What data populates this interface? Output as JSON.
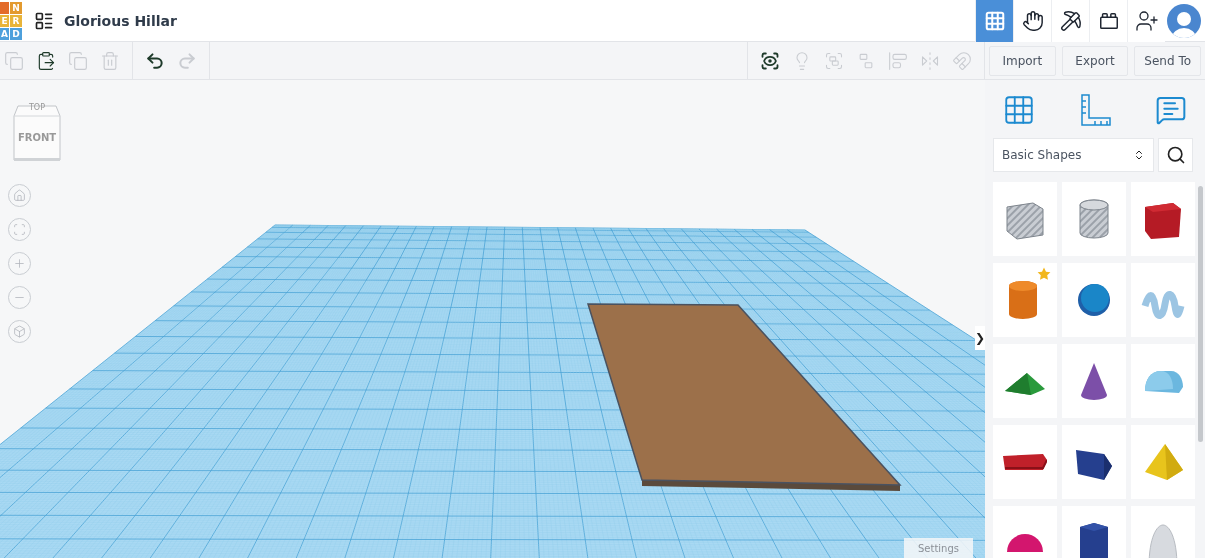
{
  "logo": {
    "cells": [
      {
        "letter": "N",
        "color": "#e39a2f"
      },
      {
        "letter": "E",
        "color": "#e8b43a"
      },
      {
        "letter": "R",
        "color": "#e8b43a"
      },
      {
        "letter": "A",
        "color": "#4da0dc"
      },
      {
        "letter": "D",
        "color": "#4da0dc"
      }
    ]
  },
  "design_title": "Glorious Hillar",
  "view_modes": [
    {
      "kind": "design",
      "selected": true
    },
    {
      "kind": "circuits",
      "selected": false
    },
    {
      "kind": "minecraft",
      "selected": false
    },
    {
      "kind": "bricks",
      "selected": false
    }
  ],
  "edit_tools": [
    {
      "kind": "copy",
      "disabled": true
    },
    {
      "kind": "paste",
      "disabled": false
    },
    {
      "kind": "duplicate",
      "disabled": true
    },
    {
      "kind": "delete",
      "disabled": true
    }
  ],
  "history_tools": [
    {
      "kind": "undo",
      "disabled": false
    },
    {
      "kind": "redo",
      "disabled": true
    }
  ],
  "shape_tools": [
    {
      "kind": "notes",
      "disabled": false
    },
    {
      "kind": "light",
      "disabled": true
    },
    {
      "kind": "group",
      "disabled": true
    },
    {
      "kind": "ungroup",
      "disabled": true
    },
    {
      "kind": "align",
      "disabled": true
    },
    {
      "kind": "mirror",
      "disabled": true
    },
    {
      "kind": "magnet",
      "disabled": true
    }
  ],
  "actions": [
    "Import",
    "Export",
    "Send To"
  ],
  "view_cube": {
    "top": "TOP",
    "front": "FRONT"
  },
  "nav_controls": [
    {
      "kind": "home"
    },
    {
      "kind": "fit"
    },
    {
      "kind": "zoom-in"
    },
    {
      "kind": "zoom-out"
    },
    {
      "kind": "perspective"
    }
  ],
  "settings": "Settings",
  "panel_toggle": "❯",
  "panel_tools": [
    {
      "kind": "workplane"
    },
    {
      "kind": "ruler"
    },
    {
      "kind": "notes"
    }
  ],
  "library": {
    "value": "Basic Shapes"
  },
  "shapes": [
    {
      "kind": "box-hole",
      "favorite": false
    },
    {
      "kind": "cylinder-hole",
      "favorite": false
    },
    {
      "kind": "box",
      "favorite": false
    },
    {
      "kind": "cylinder",
      "favorite": true
    },
    {
      "kind": "sphere",
      "favorite": false
    },
    {
      "kind": "scribble",
      "favorite": false
    },
    {
      "kind": "roof",
      "favorite": false
    },
    {
      "kind": "cone",
      "favorite": false
    },
    {
      "kind": "round-roof",
      "favorite": false
    },
    {
      "kind": "text",
      "favorite": false
    },
    {
      "kind": "wedge-block",
      "favorite": false
    },
    {
      "kind": "pyramid",
      "favorite": false
    },
    {
      "kind": "half-sphere",
      "favorite": false
    },
    {
      "kind": "hexagonal-prism",
      "favorite": false
    },
    {
      "kind": "paraboloid",
      "favorite": false
    }
  ]
}
